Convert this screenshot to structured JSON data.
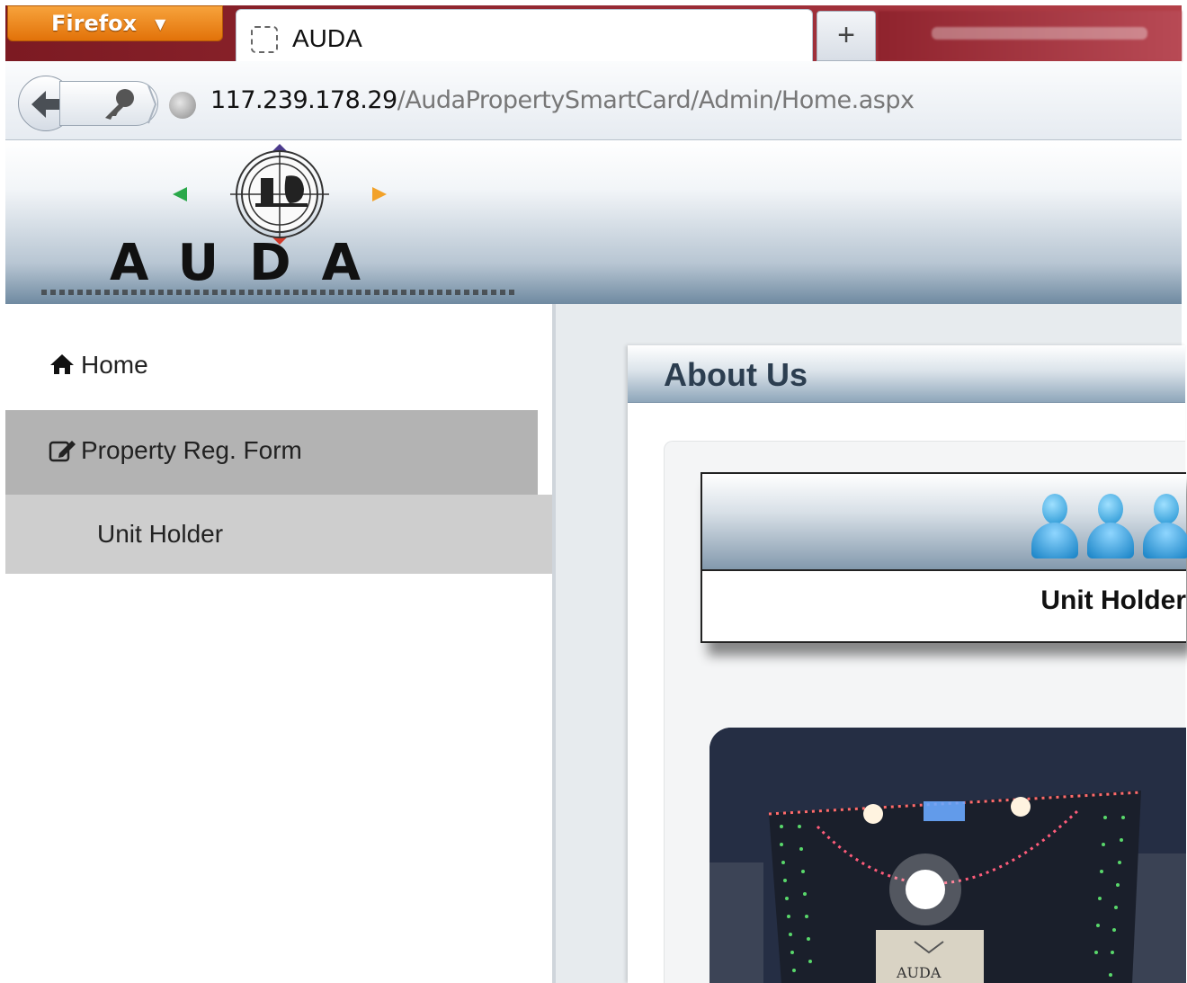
{
  "browser": {
    "menu_button_label": "Firefox",
    "tab_title": "AUDA",
    "new_tab_label": "+",
    "url_host": "117.239.178.29",
    "url_path": "/AudaPropertySmartCard/Admin/Home.aspx"
  },
  "header": {
    "logo_text": "AUDA"
  },
  "sidebar": {
    "items": [
      {
        "label": "Home",
        "icon": "home-icon"
      },
      {
        "label": "Property Reg. Form",
        "icon": "edit-icon"
      },
      {
        "label": "Unit Holder"
      }
    ]
  },
  "main": {
    "panel_title": "About Us",
    "unit_holder_label": "Unit Holder",
    "photo_sign_text": "AUDA"
  },
  "colors": {
    "firefox_orange": "#e27209",
    "selected_item": "#b3b3b3",
    "subitem": "#cecece",
    "user_icon_blue": "#1b8fd0"
  }
}
